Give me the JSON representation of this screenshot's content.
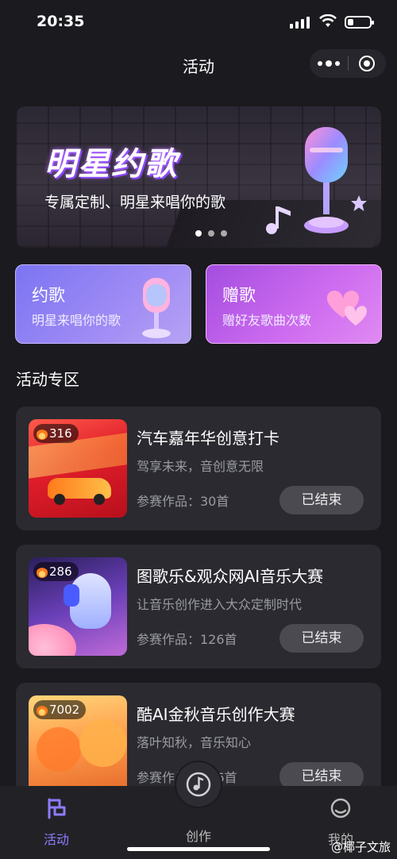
{
  "status_bar": {
    "time": "20:35"
  },
  "navbar": {
    "title": "活动"
  },
  "banner": {
    "headline": "明星约歌",
    "subtitle": "专属定制、明星来唱你的歌",
    "pages": 3,
    "active_page": 1
  },
  "quick_cards": [
    {
      "title": "约歌",
      "subtitle": "明星来唱你的歌"
    },
    {
      "title": "赠歌",
      "subtitle": "赠好友歌曲次数"
    }
  ],
  "section_title": "活动专区",
  "activities": [
    {
      "hot": "316",
      "name": "汽车嘉年华创意打卡",
      "desc": "驾享未来，音创意无限",
      "count": "参赛作品：30首",
      "status": "已结束"
    },
    {
      "hot": "286",
      "name": "图歌乐&观众网AI音乐大赛",
      "desc": "让音乐创作进入大众定制时代",
      "count": "参赛作品：126首",
      "status": "已结束"
    },
    {
      "hot": "7002",
      "name": "酷AI金秋音乐创作大赛",
      "desc": "落叶知秋，音乐知心",
      "count": "参赛作品：306首",
      "status": "已结束"
    }
  ],
  "tabbar": {
    "items": [
      "活动",
      "创作",
      "我的"
    ],
    "active": "活动"
  },
  "watermark": "@椰子文旅",
  "colors": {
    "accent": "#8c7cff",
    "background": "#1a1a1f",
    "card": "#2a2a30"
  }
}
